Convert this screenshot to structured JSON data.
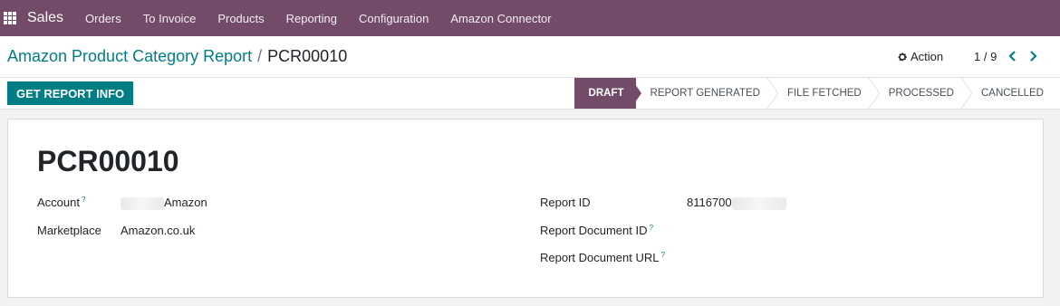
{
  "navbar": {
    "brand": "Sales",
    "menu": [
      "Orders",
      "To Invoice",
      "Products",
      "Reporting",
      "Configuration",
      "Amazon Connector"
    ]
  },
  "control": {
    "breadcrumb_parent": "Amazon Product Category Report",
    "breadcrumb_separator": "/",
    "breadcrumb_current": "PCR00010",
    "action_label": "Action",
    "pager": "1 / 9"
  },
  "statusbar": {
    "button_label": "GET REPORT INFO",
    "stages": [
      "DRAFT",
      "REPORT GENERATED",
      "FILE FETCHED",
      "PROCESSED",
      "CANCELLED"
    ],
    "active_stage": "DRAFT"
  },
  "form": {
    "name": "PCR00010",
    "left": [
      {
        "label": "Account",
        "value": "Amazon",
        "help": "?"
      },
      {
        "label": "Marketplace",
        "value": "Amazon.co.uk"
      }
    ],
    "right": [
      {
        "label": "Report ID",
        "value": "8116700"
      },
      {
        "label": "Report Document ID",
        "value": "",
        "help": "?"
      },
      {
        "label": "Report Document URL",
        "value": "",
        "help": "?"
      }
    ]
  },
  "colors": {
    "brand": "#714b67",
    "accent": "#017e84"
  }
}
